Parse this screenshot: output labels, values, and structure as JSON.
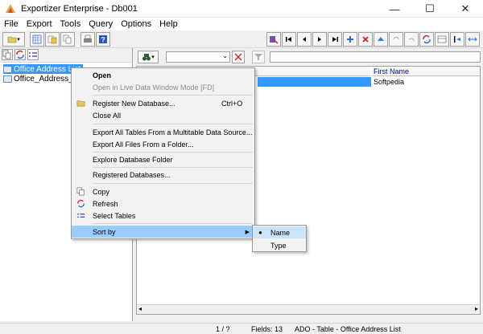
{
  "window": {
    "title": "Exportizer Enterprise - Db001",
    "controls": {
      "minimize": "—",
      "maximize": "☐",
      "close": "✕"
    }
  },
  "menu": [
    "File",
    "Export",
    "Tools",
    "Query",
    "Options",
    "Help"
  ],
  "tree": {
    "items": [
      "Office Address List",
      "Office_Address_List"
    ]
  },
  "grid": {
    "header": "First Name",
    "cell": "Softpedia"
  },
  "context_menu": {
    "items": [
      {
        "label": "Open"
      },
      {
        "label": "Open in Live Data Window Mode [FD]"
      },
      {
        "label": "Register New Database...",
        "shortcut": "Ctrl+O"
      },
      {
        "label": "Close All"
      },
      {
        "label": "Export All Tables From a Multitable Data Source..."
      },
      {
        "label": "Export All Files From a Folder..."
      },
      {
        "label": "Explore Database Folder"
      },
      {
        "label": "Registered Databases..."
      },
      {
        "label": "Copy"
      },
      {
        "label": "Refresh"
      },
      {
        "label": "Select Tables"
      },
      {
        "label": "Sort by"
      }
    ]
  },
  "sort_submenu": {
    "items": [
      "Name",
      "Type"
    ],
    "selected": "Name"
  },
  "statusbar": {
    "position": "1 / ?",
    "fields": "Fields: 13",
    "source": "ADO - Table - Office Address List"
  },
  "colors": {
    "selection": "#3399ff",
    "menu_highlight": "#99ccff"
  }
}
